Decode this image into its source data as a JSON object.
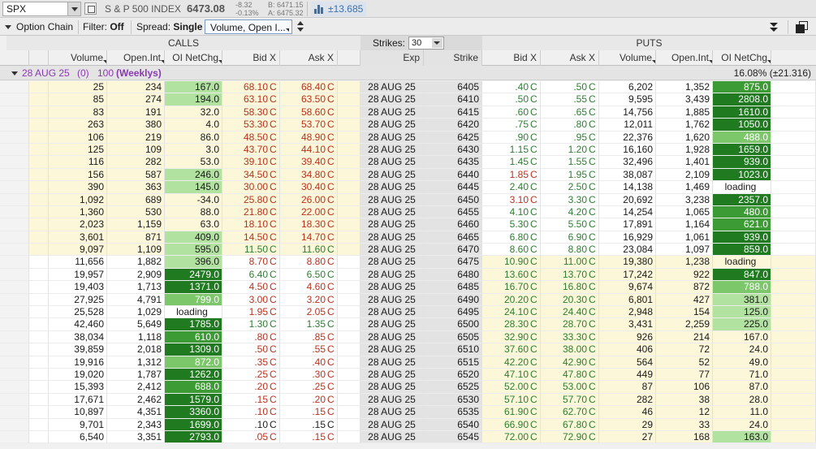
{
  "toolbar": {
    "symbol": "SPX",
    "description": "S & P 500 INDEX",
    "last": "6473.08",
    "net_change": "-8.32",
    "pct_change": "-0.13%",
    "bid": "B: 6471.15",
    "ask": "A: 6475.32",
    "impl_move": "±13.685"
  },
  "optionbar": {
    "title": "Option Chain",
    "filter_label": "Filter:",
    "filter_value": "Off",
    "spread_label": "Spread:",
    "spread_value": "Single",
    "layout_value": "Volume, Open I...",
    "calls_label": "CALLS",
    "puts_label": "PUTS",
    "strikes_label": "Strikes:",
    "strikes_value": "30"
  },
  "columns": {
    "calls": [
      "Volume",
      "Open.Int",
      "OI NetChg",
      "Bid X",
      "Ask X"
    ],
    "mid": [
      "Exp",
      "Strike"
    ],
    "puts": [
      "Bid X",
      "Ask X",
      "Volume",
      "Open.Int",
      "OI NetChg"
    ]
  },
  "expiration": {
    "label": "28 AUG 25",
    "dte": "(0)",
    "mult": "100",
    "tag": "(Weeklys)",
    "iv": "16.08% (±21.316)"
  },
  "rows": [
    {
      "cv": "25",
      "co": "234",
      "cn": "167.0",
      "ch": 1,
      "cb": "68.10",
      "ca": "68.40",
      "ccol": "red",
      "exp": "28 AUG 25",
      "k": "6405",
      "pb": ".40",
      "pa": ".50",
      "pcol": "grn",
      "pv": "6,202",
      "po": "1,352",
      "pn": "875.0",
      "ph": 3
    },
    {
      "cv": "85",
      "co": "274",
      "cn": "194.0",
      "ch": 1,
      "cb": "63.10",
      "ca": "63.50",
      "ccol": "red",
      "exp": "28 AUG 25",
      "k": "6410",
      "pb": ".50",
      "pa": ".55",
      "pcol": "grn",
      "pv": "9,595",
      "po": "3,439",
      "pn": "2808.0",
      "ph": 4
    },
    {
      "cv": "83",
      "co": "191",
      "cn": "32.0",
      "ch": 0,
      "cb": "58.30",
      "ca": "58.60",
      "ccol": "red",
      "exp": "28 AUG 25",
      "k": "6415",
      "pb": ".60",
      "pa": ".65",
      "pcol": "grn",
      "pv": "14,756",
      "po": "1,885",
      "pn": "1610.0",
      "ph": 4
    },
    {
      "cv": "263",
      "co": "380",
      "cn": "4.0",
      "ch": 0,
      "cb": "53.30",
      "ca": "53.70",
      "ccol": "red",
      "exp": "28 AUG 25",
      "k": "6420",
      "pb": ".75",
      "pa": ".80",
      "pcol": "grn",
      "pv": "12,011",
      "po": "1,762",
      "pn": "1050.0",
      "ph": 4
    },
    {
      "cv": "106",
      "co": "219",
      "cn": "86.0",
      "ch": 0,
      "cb": "48.50",
      "ca": "48.90",
      "ccol": "red",
      "exp": "28 AUG 25",
      "k": "6425",
      "pb": ".90",
      "pa": ".95",
      "pcol": "grn",
      "pv": "22,376",
      "po": "1,620",
      "pn": "488.0",
      "ph": 2
    },
    {
      "cv": "125",
      "co": "109",
      "cn": "3.0",
      "ch": 0,
      "cb": "43.70",
      "ca": "44.10",
      "ccol": "red",
      "exp": "28 AUG 25",
      "k": "6430",
      "pb": "1.15",
      "pa": "1.20",
      "pcol": "grn",
      "pv": "16,160",
      "po": "1,928",
      "pn": "1659.0",
      "ph": 4
    },
    {
      "cv": "116",
      "co": "282",
      "cn": "53.0",
      "ch": 0,
      "cb": "39.10",
      "ca": "39.40",
      "ccol": "red",
      "exp": "28 AUG 25",
      "k": "6435",
      "pb": "1.45",
      "pa": "1.55",
      "pcol": "grn",
      "pv": "32,496",
      "po": "1,401",
      "pn": "939.0",
      "ph": 4
    },
    {
      "cv": "156",
      "co": "587",
      "cn": "246.0",
      "ch": 1,
      "cb": "34.50",
      "ca": "34.80",
      "ccol": "red",
      "exp": "28 AUG 25",
      "k": "6440",
      "pb": "1.85",
      "pa": "1.95",
      "pcol": "red",
      "pv": "38,087",
      "po": "2,109",
      "pn": "1023.0",
      "ph": 4
    },
    {
      "cv": "390",
      "co": "363",
      "cn": "145.0",
      "ch": 1,
      "cb": "30.00",
      "ca": "30.40",
      "ccol": "red",
      "exp": "28 AUG 25",
      "k": "6445",
      "pb": "2.40",
      "pa": "2.50",
      "pcol": "grn",
      "pv": "14,138",
      "po": "1,469",
      "pn": "loading",
      "ph": 0
    },
    {
      "cv": "1,092",
      "co": "689",
      "cn": "-34.0",
      "ch": 0,
      "cb": "25.80",
      "ca": "26.00",
      "ccol": "red",
      "exp": "28 AUG 25",
      "k": "6450",
      "pb": "3.10",
      "pa": "3.30",
      "pcol": "red",
      "pv": "20,692",
      "po": "3,238",
      "pn": "2357.0",
      "ph": 4
    },
    {
      "cv": "1,360",
      "co": "530",
      "cn": "88.0",
      "ch": 0,
      "cb": "21.80",
      "ca": "22.00",
      "ccol": "red",
      "exp": "28 AUG 25",
      "k": "6455",
      "pb": "4.10",
      "pa": "4.20",
      "pcol": "grn",
      "pv": "14,254",
      "po": "1,065",
      "pn": "480.0",
      "ph": 3
    },
    {
      "cv": "2,023",
      "co": "1,159",
      "cn": "63.0",
      "ch": 0,
      "cb": "18.10",
      "ca": "18.30",
      "ccol": "red",
      "exp": "28 AUG 25",
      "k": "6460",
      "pb": "5.30",
      "pa": "5.50",
      "pcol": "grn",
      "pv": "17,891",
      "po": "1,164",
      "pn": "621.0",
      "ph": 3
    },
    {
      "cv": "3,601",
      "co": "871",
      "cn": "409.0",
      "ch": 1,
      "cb": "14.50",
      "ca": "14.70",
      "ccol": "red",
      "exp": "28 AUG 25",
      "k": "6465",
      "pb": "6.80",
      "pa": "6.90",
      "pcol": "grn",
      "pv": "16,929",
      "po": "1,061",
      "pn": "939.0",
      "ph": 4
    },
    {
      "cv": "9,097",
      "co": "1,109",
      "cn": "595.0",
      "ch": 1,
      "cb": "11.50",
      "ca": "11.60",
      "ccol": "grn",
      "exp": "28 AUG 25",
      "k": "6470",
      "pb": "8.60",
      "pa": "8.80",
      "pcol": "grn",
      "pv": "23,084",
      "po": "1,097",
      "pn": "859.0",
      "ph": 4
    },
    {
      "cv": "11,656",
      "co": "1,882",
      "cn": "396.0",
      "ch": 1,
      "cb": "8.70",
      "ca": "8.80",
      "ccol": "red",
      "exp": "28 AUG 25",
      "k": "6475",
      "pb": "10.90",
      "pa": "11.00",
      "pcol": "grn",
      "pv": "19,380",
      "po": "1,238",
      "pn": "loading",
      "ph": 0
    },
    {
      "cv": "19,957",
      "co": "2,909",
      "cn": "2479.0",
      "ch": 4,
      "cb": "6.40",
      "ca": "6.50",
      "ccol": "grn",
      "exp": "28 AUG 25",
      "k": "6480",
      "pb": "13.60",
      "pa": "13.70",
      "pcol": "grn",
      "pv": "17,242",
      "po": "922",
      "pn": "847.0",
      "ph": 4
    },
    {
      "cv": "19,403",
      "co": "1,713",
      "cn": "1371.0",
      "ch": 4,
      "cb": "4.50",
      "ca": "4.60",
      "ccol": "red",
      "exp": "28 AUG 25",
      "k": "6485",
      "pb": "16.70",
      "pa": "16.80",
      "pcol": "grn",
      "pv": "9,674",
      "po": "872",
      "pn": "788.0",
      "ph": 2
    },
    {
      "cv": "27,925",
      "co": "4,791",
      "cn": "799.0",
      "ch": 2,
      "cb": "3.00",
      "ca": "3.20",
      "ccol": "red",
      "exp": "28 AUG 25",
      "k": "6490",
      "pb": "20.20",
      "pa": "20.30",
      "pcol": "grn",
      "pv": "6,801",
      "po": "427",
      "pn": "381.0",
      "ph": 1
    },
    {
      "cv": "25,528",
      "co": "1,029",
      "cn": "loading",
      "ch": 0,
      "cb": "1.95",
      "ca": "2.05",
      "ccol": "red",
      "exp": "28 AUG 25",
      "k": "6495",
      "pb": "24.10",
      "pa": "24.40",
      "pcol": "grn",
      "pv": "2,948",
      "po": "154",
      "pn": "125.0",
      "ph": 1
    },
    {
      "cv": "42,460",
      "co": "5,649",
      "cn": "1785.0",
      "ch": 4,
      "cb": "1.30",
      "ca": "1.35",
      "ccol": "grn",
      "exp": "28 AUG 25",
      "k": "6500",
      "pb": "28.30",
      "pa": "28.70",
      "pcol": "grn",
      "pv": "3,431",
      "po": "2,259",
      "pn": "225.0",
      "ph": 1
    },
    {
      "cv": "38,034",
      "co": "1,118",
      "cn": "610.0",
      "ch": 3,
      "cb": ".80",
      "ca": ".85",
      "ccol": "red",
      "exp": "28 AUG 25",
      "k": "6505",
      "pb": "32.90",
      "pa": "33.30",
      "pcol": "grn",
      "pv": "926",
      "po": "214",
      "pn": "167.0",
      "ph": 0
    },
    {
      "cv": "39,859",
      "co": "2,018",
      "cn": "1309.0",
      "ch": 4,
      "cb": ".50",
      "ca": ".55",
      "ccol": "red",
      "exp": "28 AUG 25",
      "k": "6510",
      "pb": "37.60",
      "pa": "38.00",
      "pcol": "grn",
      "pv": "406",
      "po": "72",
      "pn": "24.0",
      "ph": 0
    },
    {
      "cv": "19,916",
      "co": "1,312",
      "cn": "872.0",
      "ch": 2,
      "cb": ".35",
      "ca": ".40",
      "ccol": "red",
      "exp": "28 AUG 25",
      "k": "6515",
      "pb": "42.20",
      "pa": "42.90",
      "pcol": "grn",
      "pv": "564",
      "po": "52",
      "pn": "49.0",
      "ph": 0
    },
    {
      "cv": "19,020",
      "co": "1,787",
      "cn": "1262.0",
      "ch": 4,
      "cb": ".25",
      "ca": ".30",
      "ccol": "red",
      "exp": "28 AUG 25",
      "k": "6520",
      "pb": "47.10",
      "pa": "47.80",
      "pcol": "grn",
      "pv": "449",
      "po": "77",
      "pn": "71.0",
      "ph": 0
    },
    {
      "cv": "15,393",
      "co": "2,412",
      "cn": "688.0",
      "ch": 3,
      "cb": ".20",
      "ca": ".25",
      "ccol": "red",
      "exp": "28 AUG 25",
      "k": "6525",
      "pb": "52.00",
      "pa": "53.00",
      "pcol": "grn",
      "pv": "87",
      "po": "106",
      "pn": "87.0",
      "ph": 0
    },
    {
      "cv": "17,671",
      "co": "2,462",
      "cn": "1579.0",
      "ch": 4,
      "cb": ".15",
      "ca": ".20",
      "ccol": "red",
      "exp": "28 AUG 25",
      "k": "6530",
      "pb": "57.10",
      "pa": "57.70",
      "pcol": "grn",
      "pv": "282",
      "po": "38",
      "pn": "28.0",
      "ph": 0
    },
    {
      "cv": "10,897",
      "co": "4,351",
      "cn": "3360.0",
      "ch": 4,
      "cb": ".10",
      "ca": ".15",
      "ccol": "red",
      "exp": "28 AUG 25",
      "k": "6535",
      "pb": "61.90",
      "pa": "62.70",
      "pcol": "grn",
      "pv": "46",
      "po": "12",
      "pn": "11.0",
      "ph": 0
    },
    {
      "cv": "9,701",
      "co": "2,343",
      "cn": "1699.0",
      "ch": 4,
      "cb": ".10",
      "ca": ".15",
      "ccol": "blk",
      "exp": "28 AUG 25",
      "k": "6540",
      "pb": "66.90",
      "pa": "67.80",
      "pcol": "grn",
      "pv": "29",
      "po": "33",
      "pn": "24.0",
      "ph": 0
    },
    {
      "cv": "6,540",
      "co": "3,351",
      "cn": "2793.0",
      "ch": 4,
      "cb": ".05",
      "ca": ".15",
      "ccol": "red",
      "exp": "28 AUG 25",
      "k": "6545",
      "pb": "72.00",
      "pa": "72.90",
      "pcol": "grn",
      "pv": "27",
      "po": "168",
      "pn": "163.0",
      "ph": 1
    }
  ],
  "itm_split": {
    "calls_itm_rows": 14,
    "puts_itm_from_row": 14
  },
  "exch": "C",
  "colors": {
    "call_red": "#b83220",
    "put_green": "#2e7d32",
    "itm_bg": "#fbf7d8",
    "weeklys_purple": "#8a3ab0"
  }
}
